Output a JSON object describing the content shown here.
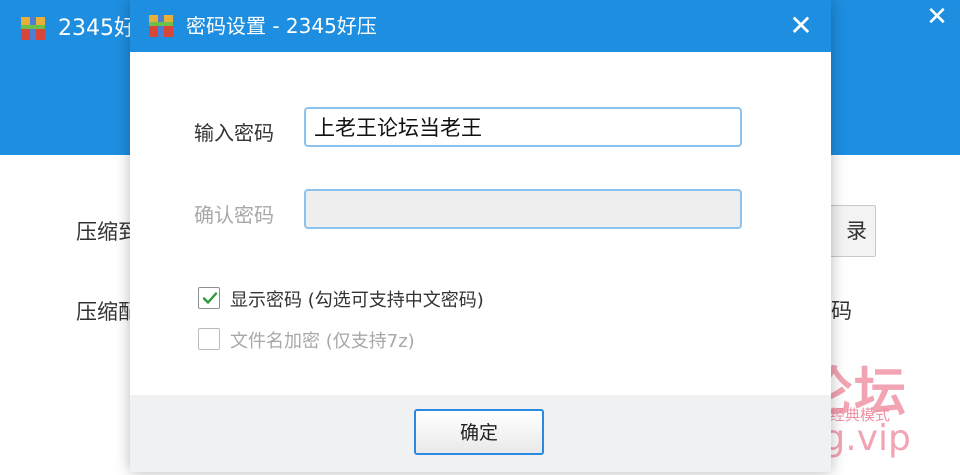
{
  "background_window": {
    "title": "2345好",
    "row1_label": "压缩到",
    "row2_label": "压缩配",
    "browse_button_label": "录",
    "password_text": "密码"
  },
  "dialog": {
    "title": "密码设置 - 2345好压",
    "password_label": "输入密码",
    "password_value": "上老王论坛当老王",
    "confirm_label": "确认密码",
    "confirm_value": "",
    "show_password_label": "显示密码 (勾选可支持中文密码)",
    "show_password_checked": true,
    "encrypt_filename_label": "文件名加密  (仅支持7z)",
    "encrypt_filename_checked": false,
    "ok_button_label": "确定"
  },
  "watermark": {
    "main": "老王论坛",
    "sub": "经典模式",
    "url": "laowang.vip"
  },
  "colors": {
    "title_bar": "#1e8ee0",
    "input_border": "#8cc3ee",
    "button_border": "#2a8ae0",
    "watermark": "#f2a4b3"
  },
  "icons": {
    "app_icon": "2345-haozip-icon",
    "close": "close-icon",
    "check": "checkmark-icon"
  }
}
